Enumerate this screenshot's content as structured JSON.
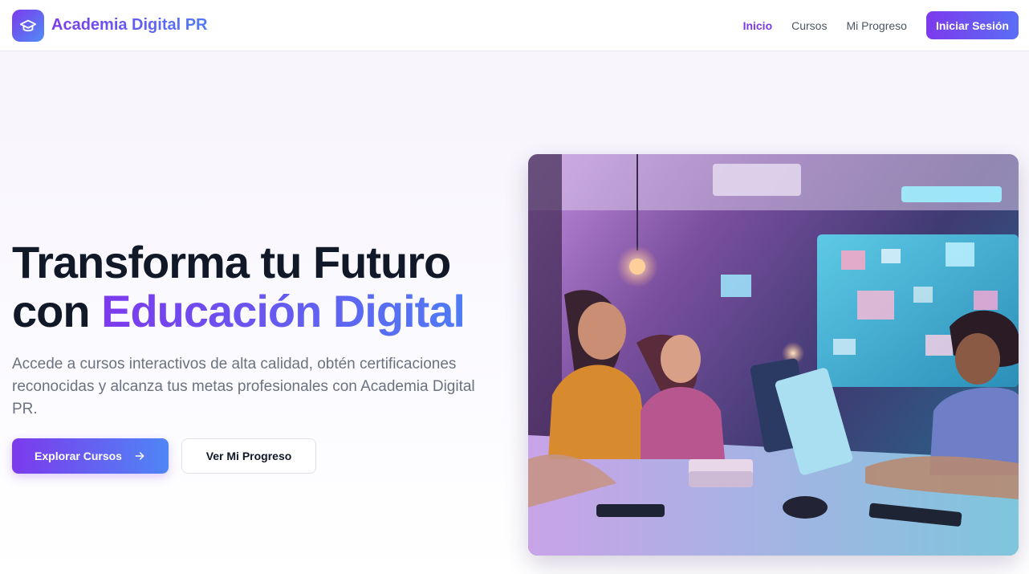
{
  "header": {
    "brand": "Academia Digital PR",
    "nav": [
      "Inicio",
      "Cursos",
      "Mi Progreso"
    ],
    "login_label": "Iniciar Sesión"
  },
  "hero": {
    "title_line1": "Transforma tu Futuro",
    "title_line2_prefix": "con ",
    "title_line2_accent": "Educación Digital",
    "subtitle": "Accede a cursos interactivos de alta calidad, obtén certificaciones reconocidas y alcanza tus metas profesionales con Academia Digital PR.",
    "primary_button": "Explorar Cursos",
    "secondary_button": "Ver Mi Progreso"
  },
  "colors": {
    "accent_purple": "#7c3aed",
    "accent_blue": "#4f7cf5",
    "title_dark": "#111827",
    "muted_text": "#6b7280"
  },
  "icons": {
    "logo": "graduation-cap-icon",
    "primary_button": "arrow-right-icon"
  }
}
